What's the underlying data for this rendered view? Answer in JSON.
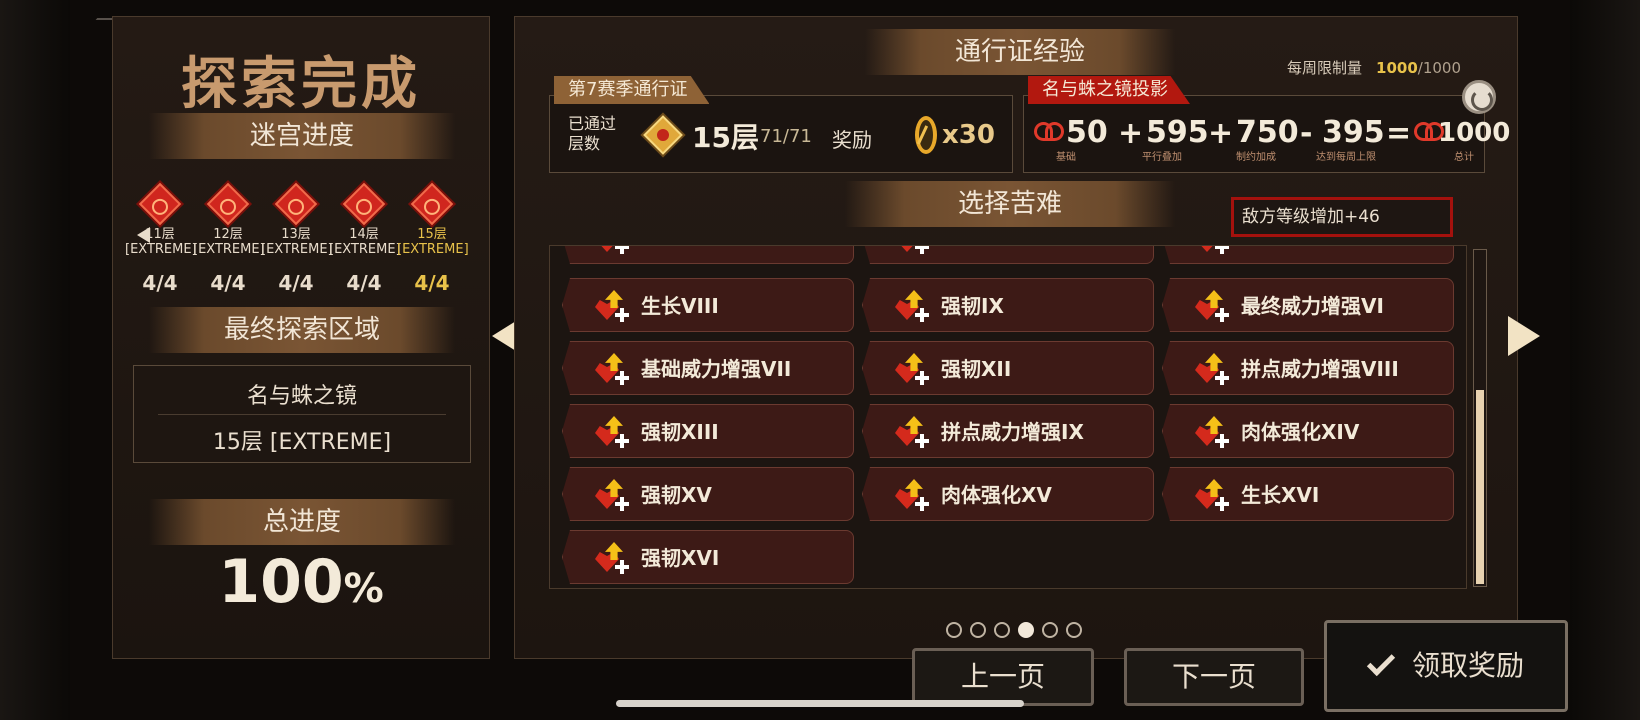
{
  "left": {
    "title": "探索完成",
    "maze_progress_label": "迷宫进度",
    "floors": [
      {
        "name": "11层",
        "mode": "[EXTREME]",
        "count": "4/4",
        "active": false
      },
      {
        "name": "12层",
        "mode": "[EXTREME]",
        "count": "4/4",
        "active": false
      },
      {
        "name": "13层",
        "mode": "[EXTREME]",
        "count": "4/4",
        "active": false
      },
      {
        "name": "14层",
        "mode": "[EXTREME]",
        "count": "4/4",
        "active": false
      },
      {
        "name": "15层",
        "mode": "[EXTREME]",
        "count": "4/4",
        "active": true
      }
    ],
    "final_area_label": "最终探索区域",
    "final_area_name": "名与蛛之镜",
    "final_area_floor": "15层 [EXTREME]",
    "total_progress_label": "总进度",
    "total_progress_value": "100",
    "total_progress_unit": "%"
  },
  "right": {
    "pass_exp_label": "通行证经验",
    "weekly_limit_label": "每周限制量",
    "weekly_limit_value": "1000",
    "weekly_limit_max": "/1000",
    "season_tag": "第7赛季通行证",
    "passed_floors_label": "已通过层数",
    "passed_floors_value": "15层",
    "passed_count": "71/71",
    "reward_label": "奖励",
    "reward_mult": "x30",
    "projection_tag": "名与蛛之镜投影",
    "calc": {
      "base": "50",
      "base_label": "基础",
      "parallel": "595",
      "parallel_label": "平行叠加",
      "contract": "750",
      "contract_label": "制约加成",
      "cap": "395",
      "cap_label": "达到每周上限",
      "total": "1000",
      "total_label": "总计",
      "plus": "+",
      "minus": "-",
      "equals": "="
    },
    "hardship_label": "选择苦难",
    "enemy_level_text": "敌方等级增加+46",
    "cards": [
      {
        "label": "生长VIII"
      },
      {
        "label": "强韧IX"
      },
      {
        "label": "最终威力增强VI"
      },
      {
        "label": "基础威力增强VII"
      },
      {
        "label": "强韧XII"
      },
      {
        "label": "拼点威力增强VIII"
      },
      {
        "label": "强韧XIII"
      },
      {
        "label": "拼点威力增强IX"
      },
      {
        "label": "肉体强化XIV"
      },
      {
        "label": "强韧XV"
      },
      {
        "label": "肉体强化XV"
      },
      {
        "label": "生长XVI"
      },
      {
        "label": "强韧XVI"
      }
    ],
    "page_dots": {
      "total": 6,
      "active": 4
    }
  },
  "buttons": {
    "prev": "上一页",
    "next": "下一页",
    "claim": "领取奖励"
  },
  "colors": {
    "accent_gold": "#e8c24a",
    "red_tag": "#b2180f",
    "card_bg": "#3d1a16"
  }
}
